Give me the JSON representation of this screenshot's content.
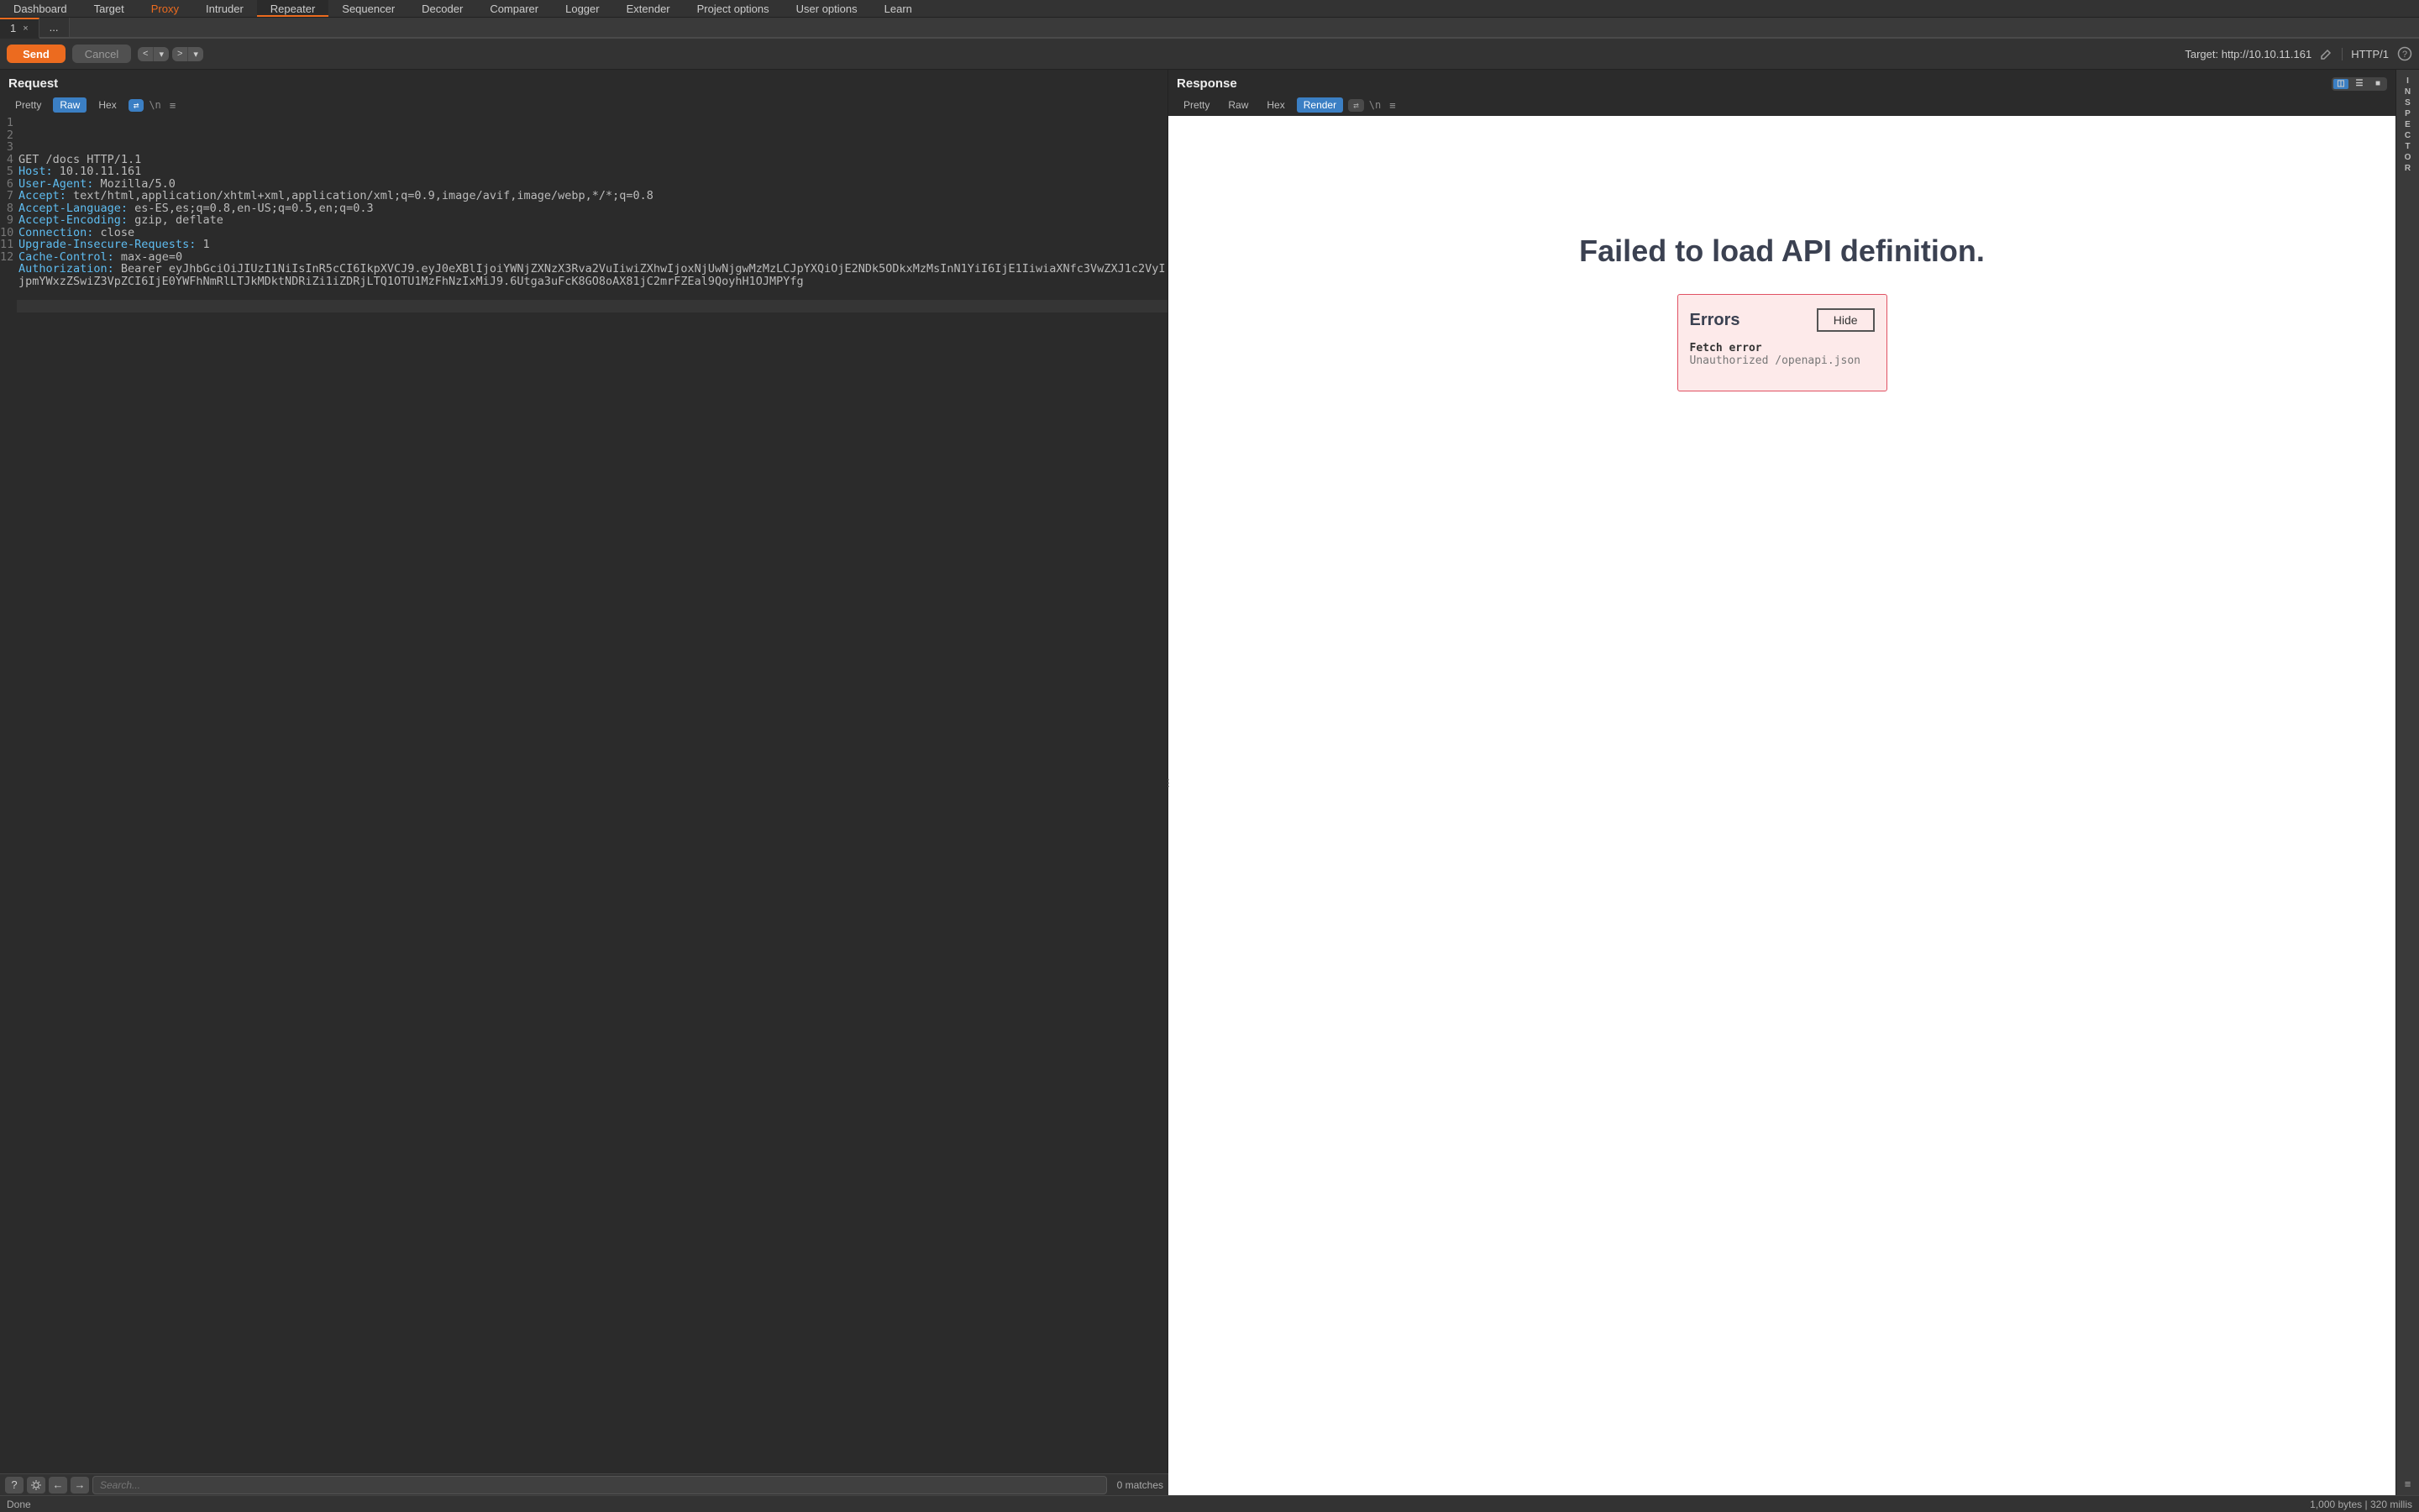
{
  "menu": [
    "Dashboard",
    "Target",
    "Proxy",
    "Intruder",
    "Repeater",
    "Sequencer",
    "Decoder",
    "Comparer",
    "Logger",
    "Extender",
    "Project options",
    "User options",
    "Learn"
  ],
  "menu_active": "Proxy",
  "menu_highlight": "Repeater",
  "subtabs": {
    "active_label": "1",
    "dots": "..."
  },
  "toolbar": {
    "send": "Send",
    "cancel": "Cancel",
    "target_label": "Target: http://10.10.11.161",
    "http_version": "HTTP/1"
  },
  "request": {
    "title": "Request",
    "views": [
      "Pretty",
      "Raw",
      "Hex"
    ],
    "active_view": "Raw",
    "lines": [
      [
        {
          "t": "GET /docs HTTP/1.1",
          "c": ""
        }
      ],
      [
        {
          "t": "Host:",
          "c": "hk"
        },
        {
          "t": " 10.10.11.161",
          "c": ""
        }
      ],
      [
        {
          "t": "User-Agent:",
          "c": "hk"
        },
        {
          "t": " Mozilla/5.0",
          "c": ""
        }
      ],
      [
        {
          "t": "Accept:",
          "c": "hk"
        },
        {
          "t": " text/html,application/xhtml+xml,application/xml;q=0.9,image/avif,image/webp,*/*;q=0.8",
          "c": ""
        }
      ],
      [
        {
          "t": "Accept-Language:",
          "c": "hk"
        },
        {
          "t": " es-ES,es;q=0.8,en-US;q=0.5,en;q=0.3",
          "c": ""
        }
      ],
      [
        {
          "t": "Accept-Encoding:",
          "c": "hk"
        },
        {
          "t": " gzip, deflate",
          "c": ""
        }
      ],
      [
        {
          "t": "Connection:",
          "c": "hk"
        },
        {
          "t": " close",
          "c": ""
        }
      ],
      [
        {
          "t": "Upgrade-Insecure-Requests:",
          "c": "hk"
        },
        {
          "t": " 1",
          "c": ""
        }
      ],
      [
        {
          "t": "Cache-Control:",
          "c": "hk"
        },
        {
          "t": " max-age=0",
          "c": ""
        }
      ],
      [
        {
          "t": "Authorization:",
          "c": "hk"
        },
        {
          "t": " Bearer eyJhbGciOiJIUzI1NiIsInR5cCI6IkpXVCJ9.eyJ0eXBlIjoiYWNjZXNzX3Rva2VuIiwiZXhwIjoxNjUwNjgwMzMzLCJpYXQiOjE2NDk5ODkxMzMsInN1YiI6IjE1IiwiaXNfc3VwZXJ1c2VyIjpmYWxzZSwiZ3VpZCI6IjE0YWFhNmRlLTJkMDktNDRiZi1iZDRjLTQ1OTU1MzFhNzIxMiJ9.6Utga3uFcK8GO8oAX81jC2mrFZEal9QoyhH1OJMPYfg",
          "c": ""
        }
      ],
      [],
      []
    ],
    "highlight_index": 11
  },
  "response": {
    "title": "Response",
    "views": [
      "Pretty",
      "Raw",
      "Hex",
      "Render"
    ],
    "active_view": "Render",
    "heading": "Failed to load API definition.",
    "errors_label": "Errors",
    "hide_label": "Hide",
    "err1": "Fetch error",
    "err2": "Unauthorized /openapi.json"
  },
  "inspector_label": "INSPECTOR",
  "search": {
    "placeholder": "Search...",
    "matches": "0 matches"
  },
  "status": {
    "left": "Done",
    "right": "1,000 bytes | 320 millis"
  }
}
